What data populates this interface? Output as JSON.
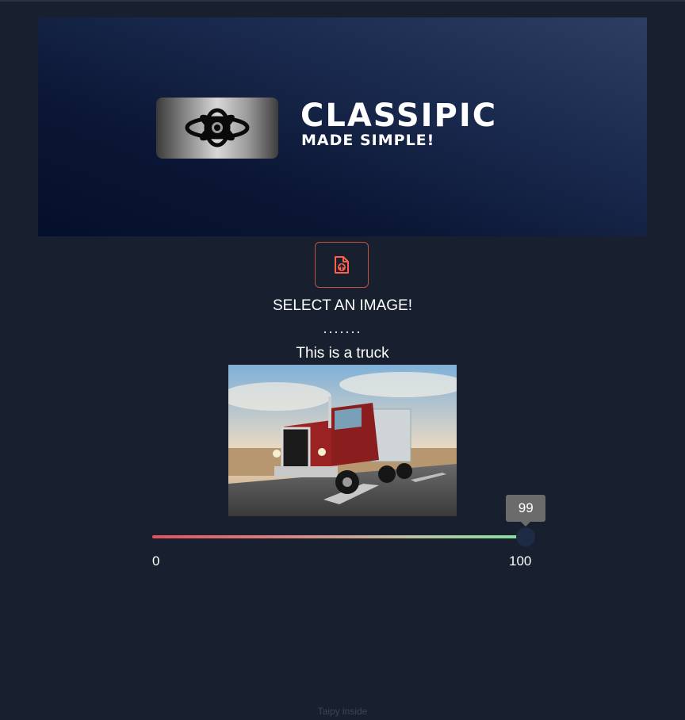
{
  "banner": {
    "title": "CLASSIPIC",
    "tagline": "MADE SIMPLE!",
    "logo_icon": "aperture-flower-icon",
    "colors": {
      "gradient_dark": "#04102b",
      "gradient_light": "#2e3e63"
    }
  },
  "upload": {
    "icon": "file-upload-icon",
    "accent_color": "#ff6049",
    "label": "SELECT AN IMAGE!"
  },
  "separator": ".......",
  "prediction": {
    "text": "This is a truck",
    "image_alt": "Red semi truck driving on highway"
  },
  "confidence": {
    "value": 99,
    "value_label": "99",
    "min": 0,
    "max": 100,
    "min_label": "0",
    "max_label": "100",
    "gradient": [
      "#e2525c",
      "#7ee29a"
    ]
  },
  "footer": {
    "text": "Taipy inside"
  }
}
